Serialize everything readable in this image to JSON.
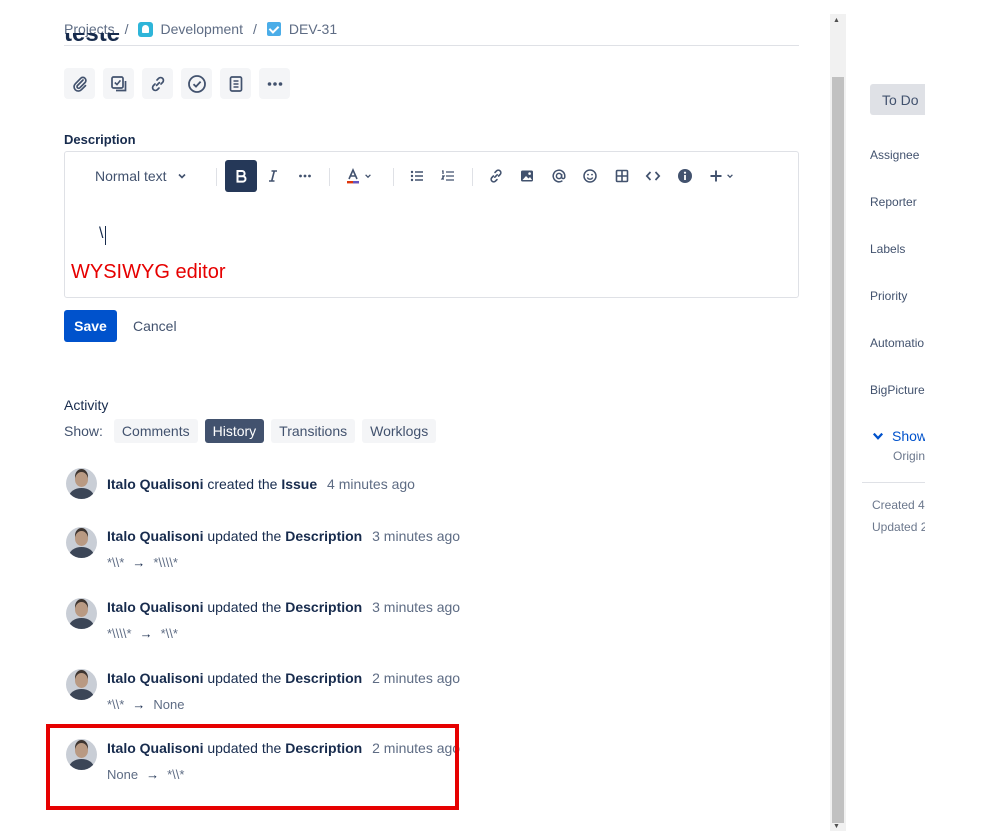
{
  "breadcrumb": {
    "projects": "Projects",
    "project": "Development",
    "issue_key": "DEV-31",
    "separator": "/"
  },
  "issue": {
    "title": "teste"
  },
  "description": {
    "label": "Description",
    "editor": {
      "text_style": "Normal text",
      "content": "\\",
      "annotation": "WYSIWYG editor"
    },
    "save_label": "Save",
    "cancel_label": "Cancel"
  },
  "activity": {
    "label": "Activity",
    "show_label": "Show:",
    "tabs": [
      "Comments",
      "History",
      "Transitions",
      "Worklogs"
    ],
    "active_tab": "History",
    "entries": [
      {
        "author": "Italo Qualisoni",
        "action": "created the",
        "field": "Issue",
        "time": "4 minutes ago"
      },
      {
        "author": "Italo Qualisoni",
        "action": "updated the",
        "field": "Description",
        "time": "3 minutes ago",
        "from": "*\\\\*",
        "to": "*\\\\\\\\*"
      },
      {
        "author": "Italo Qualisoni",
        "action": "updated the",
        "field": "Description",
        "time": "3 minutes ago",
        "from": "*\\\\\\\\*",
        "to": "*\\\\*"
      },
      {
        "author": "Italo Qualisoni",
        "action": "updated the",
        "field": "Description",
        "time": "2 minutes ago",
        "from": "*\\\\*",
        "to": "None"
      },
      {
        "author": "Italo Qualisoni",
        "action": "updated the",
        "field": "Description",
        "time": "2 minutes ago",
        "from": "None",
        "to": "*\\\\*"
      }
    ],
    "arrow": "→"
  },
  "side_panel": {
    "status": "To Do",
    "fields": [
      "Assignee",
      "Reporter",
      "Labels",
      "Priority",
      "Automatio",
      "BigPicture"
    ],
    "show_more": "Show",
    "origin": "Origin",
    "created": "Created 4",
    "updated": "Updated 2"
  },
  "colors": {
    "primary": "#0052cc",
    "annotation_red": "#e60000",
    "active_tab": "#42526e"
  }
}
